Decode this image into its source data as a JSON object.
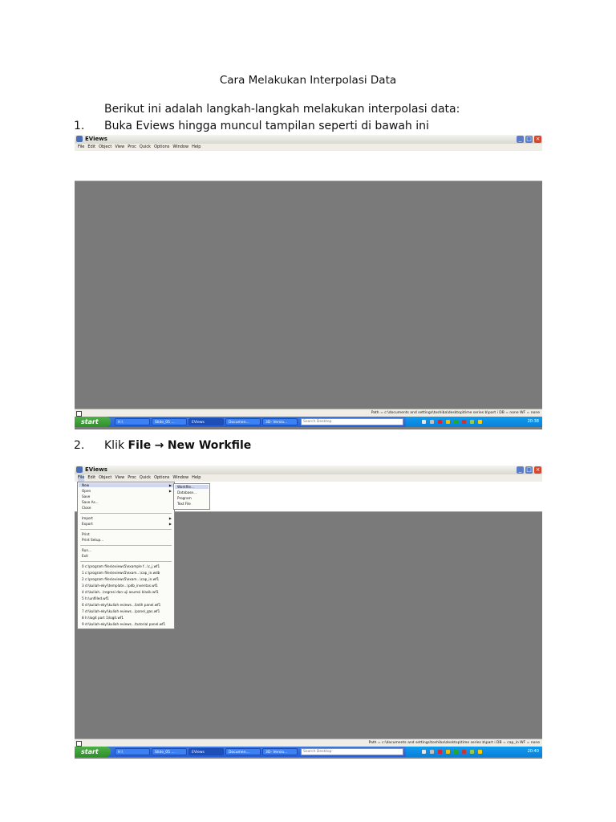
{
  "document": {
    "title": "Cara Melakukan Interpolasi Data",
    "intro": "Berikut ini adalah langkah-langkah melakukan interpolasi data:",
    "step1_num": "1.",
    "step1_text": "Buka Eviews hingga muncul tampilan seperti di bawah ini",
    "step2_num": "2.",
    "step2_prefix": "Klik ",
    "step2_file": "File",
    "step2_arrow": "→",
    "step2_target": "New Workfile"
  },
  "eviews": {
    "window_title": "EViews",
    "menu": [
      "File",
      "Edit",
      "Object",
      "View",
      "Proc",
      "Quick",
      "Options",
      "Window",
      "Help"
    ],
    "status_path": "Path = c:\\documents and settings\\toshiba\\desktop\\time series b\\part i   DB = none   WF = none",
    "status_path_2": "Path = c:\\documents and settings\\toshiba\\desktop\\time series b\\part i   DB = cap_in   WF = none"
  },
  "taskbar": {
    "start": "start",
    "tasks": [
      "H:\\",
      "Slide_05 ...",
      "EViews",
      "Documen...",
      "3D- Versio..."
    ],
    "search_placeholder": "Search Desktop",
    "clock_1": "20:38",
    "clock_2": "20:40"
  },
  "file_menu": {
    "items": [
      "New",
      "Open",
      "Save",
      "Save As...",
      "Close",
      "Import",
      "Export",
      "Print",
      "Print Setup...",
      "Run...",
      "Exit",
      "0 c:\\program files\\eviews5\\example f...\\c_j.wf1",
      "1 c:\\program files\\eviews5\\exam...\\cap_in.wdb",
      "2 c:\\program files\\eviews5\\exam...\\cap_in.wf1",
      "3 d:\\kuliah-eky\\\\template...\\pdb_inventas.wf1",
      "4 d:\\kuliah...\\regresi dan uji asumsi klasik.wf1",
      "5 h:\\unfilled.wf1",
      "6 d:\\kuliah-eky\\\\kuliah eviews...\\latih panel.wf1",
      "7 d:\\kuliah-eky\\\\kuliah eviews...\\panel_gas.wf1",
      "8 h:\\logit part 1\\logit.wf1",
      "9 d:\\kuliah-eky\\\\kuliah eviews...\\tutorial panel.wf1"
    ],
    "new_submenu": [
      "Workfile...",
      "Database...",
      "Program",
      "Text File"
    ]
  }
}
